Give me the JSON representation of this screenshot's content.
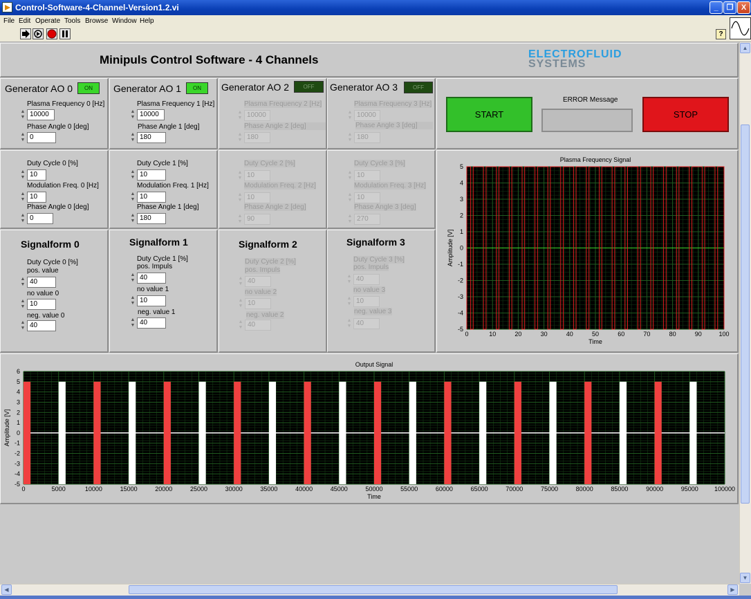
{
  "window": {
    "title": "Control-Software-4-Channel-Version1.2.vi",
    "buttons": [
      "_",
      "❐",
      "X"
    ]
  },
  "menu": [
    "File",
    "Edit",
    "Operate",
    "Tools",
    "Browse",
    "Window",
    "Help"
  ],
  "help_icon": "?",
  "header": {
    "title": "Minipuls Control Software - 4 Channels",
    "logo_line1": "ELECTROFLUID",
    "logo_line2": "SYSTEMS"
  },
  "generators": [
    {
      "title": "Generator AO 0",
      "led": "ON",
      "freq_label": "Plasma Frequency 0 [Hz]",
      "freq": "10000",
      "phase_label": "Phase Angle 0 [deg]",
      "phase": "0"
    },
    {
      "title": "Generator AO 1",
      "led": "ON",
      "freq_label": "Plasma Frequency 1 [Hz]",
      "freq": "10000",
      "phase_label": "Phase Angle 1 [deg]",
      "phase": "180"
    },
    {
      "title": "Generator AO 2",
      "led": "OFF",
      "freq_label": "Plasma Frequency 2 [Hz]",
      "freq": "10000",
      "phase_label": "Phase Angle 2 [deg]",
      "phase": "180"
    },
    {
      "title": "Generator AO 3",
      "led": "OFF",
      "freq_label": "Plasma Frequency 3 [Hz]",
      "freq": "10000",
      "phase_label": "Phase Angle 3 [deg]",
      "phase": "180"
    }
  ],
  "modulation": [
    {
      "duty_label": "Duty Cycle 0 [%]",
      "duty": "10",
      "mod_label": "Modulation Freq. 0 [Hz]",
      "mod": "10",
      "phase_label": "Phase Angle 0 [deg]",
      "phase": "0"
    },
    {
      "duty_label": "Duty Cycle 1 [%]",
      "duty": "10",
      "mod_label": "Modulation Freq. 1 [Hz]",
      "mod": "10",
      "phase_label": "Phase Angle 1 [deg]",
      "phase": "180"
    },
    {
      "duty_label": "Duty Cycle 2 [%]",
      "duty": "10",
      "mod_label": "Modulation Freq. 2 [Hz]",
      "mod": "10",
      "phase_label": "Phase Angle 2 [deg]",
      "phase": "90"
    },
    {
      "duty_label": "Duty Cycle 3 [%]",
      "duty": "10",
      "mod_label": "Modulation Freq. 3 [Hz]",
      "mod": "10",
      "phase_label": "Phase Angle 3 [deg]",
      "phase": "270"
    }
  ],
  "signalforms": [
    {
      "title": "Signalform  0",
      "duty_label": "Duty Cycle 0 [%]",
      "pos_label": "pos. value",
      "pos": "40",
      "no_label": "no value 0",
      "no": "10",
      "neg_label": "neg. value 0",
      "neg": "40"
    },
    {
      "title": "Signalform  1",
      "duty_label": "Duty Cycle 1 [%]",
      "pos_label": "pos. Impuls",
      "pos": "40",
      "no_label": "no value 1",
      "no": "10",
      "neg_label": "neg. value 1",
      "neg": "40"
    },
    {
      "title": "Signalform  2",
      "duty_label": "Duty Cycle 2 [%]",
      "pos_label": "pos. Impuls",
      "pos": "40",
      "no_label": "no value 2",
      "no": "10",
      "neg_label": "neg. value 2",
      "neg": "40"
    },
    {
      "title": "Signalform  3",
      "duty_label": "Duty Cycle 3 [%]",
      "pos_label": "pos. Impuls",
      "pos": "40",
      "no_label": "no value 3",
      "no": "10",
      "neg_label": "neg. value 3",
      "neg": "40"
    }
  ],
  "controls": {
    "start_label": "START",
    "stop_label": "STOP",
    "error_label": "ERROR Message",
    "error_value": ""
  },
  "colors": {
    "green": "#33c02a",
    "red": "#e0151b",
    "plot_bg": "#000000",
    "grid": "#1f5a1f",
    "white_pulse": "#ffffff",
    "red_pulse": "#f04040"
  },
  "chart_data": [
    {
      "type": "line",
      "title": "Plasma Frequency Signal",
      "xlabel": "Time",
      "ylabel": "Amplitude [V]",
      "xlim": [
        0,
        100
      ],
      "ylim": [
        -5,
        5
      ],
      "xticks": [
        0,
        10,
        20,
        30,
        40,
        50,
        60,
        70,
        80,
        90,
        100
      ],
      "yticks": [
        -5,
        -4,
        -3,
        -2,
        -1,
        0,
        1,
        2,
        3,
        4,
        5
      ],
      "series": [
        {
          "color": "white",
          "period": 5,
          "high_start": 0,
          "high_end": 4,
          "values": [
            5,
            -5
          ]
        },
        {
          "color": "red",
          "period": 5,
          "high_start": 2.5,
          "high_end": 6.5,
          "values": [
            5,
            -5
          ]
        }
      ]
    },
    {
      "type": "line",
      "title": "Output Signal",
      "xlabel": "Time",
      "ylabel": "Amplitude [V]",
      "xlim": [
        0,
        100000
      ],
      "ylim": [
        -5,
        6
      ],
      "xticks": [
        0,
        5000,
        10000,
        15000,
        20000,
        25000,
        30000,
        35000,
        40000,
        45000,
        50000,
        55000,
        60000,
        65000,
        70000,
        75000,
        80000,
        85000,
        90000,
        95000,
        100000
      ],
      "yticks": [
        -5,
        -4,
        -3,
        -2,
        -1,
        0,
        1,
        2,
        3,
        4,
        5,
        6
      ],
      "series": [
        {
          "color": "red",
          "pulse_starts": [
            0,
            10000,
            20000,
            30000,
            40000,
            50000,
            60000,
            70000,
            80000,
            90000
          ],
          "pulse_width": 1000,
          "amplitude": [
            5,
            -5
          ]
        },
        {
          "color": "white",
          "pulse_starts": [
            5000,
            15000,
            25000,
            35000,
            45000,
            55000,
            65000,
            75000,
            85000,
            95000
          ],
          "pulse_width": 1000,
          "amplitude": [
            5,
            -5
          ]
        }
      ]
    }
  ]
}
